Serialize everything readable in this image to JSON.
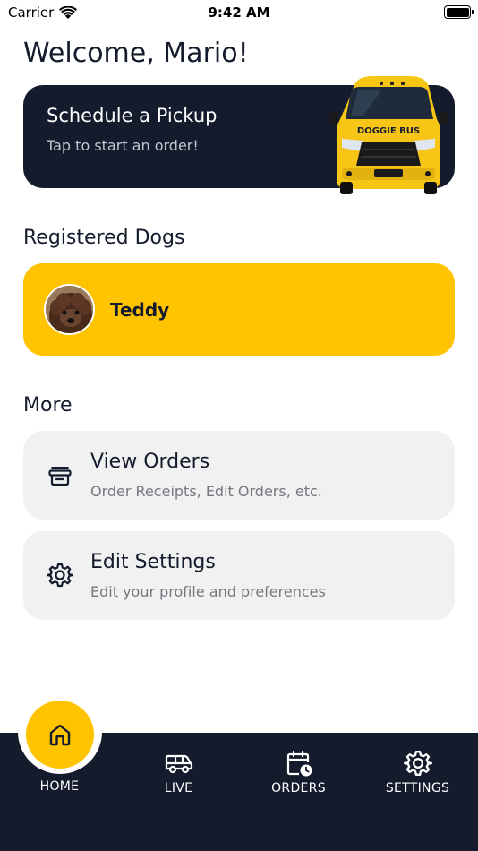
{
  "status_bar": {
    "carrier": "Carrier",
    "time": "9:42 AM"
  },
  "header": {
    "welcome": "Welcome, Mario!"
  },
  "pickup": {
    "title": "Schedule a Pickup",
    "subtitle": "Tap to start an order!",
    "bus_logo_text": "DOGGIE BUS"
  },
  "dogs_section": {
    "title": "Registered Dogs",
    "dogs": [
      {
        "name": "Teddy"
      }
    ]
  },
  "more_section": {
    "title": "More",
    "items": [
      {
        "title": "View Orders",
        "subtitle": "Order Receipts, Edit Orders, etc.",
        "icon": "archive-icon"
      },
      {
        "title": "Edit Settings",
        "subtitle": "Edit your profile and preferences",
        "icon": "gear-icon"
      }
    ]
  },
  "tabbar": {
    "tabs": [
      {
        "label": "HOME",
        "icon": "home-icon",
        "active": true
      },
      {
        "label": "LIVE",
        "icon": "van-icon"
      },
      {
        "label": "ORDERS",
        "icon": "calendar-clock-icon"
      },
      {
        "label": "SETTINGS",
        "icon": "gear-icon"
      }
    ]
  },
  "colors": {
    "navy": "#141b2d",
    "accent_yellow": "#ffc300",
    "card_gray": "#f1f1f1"
  }
}
